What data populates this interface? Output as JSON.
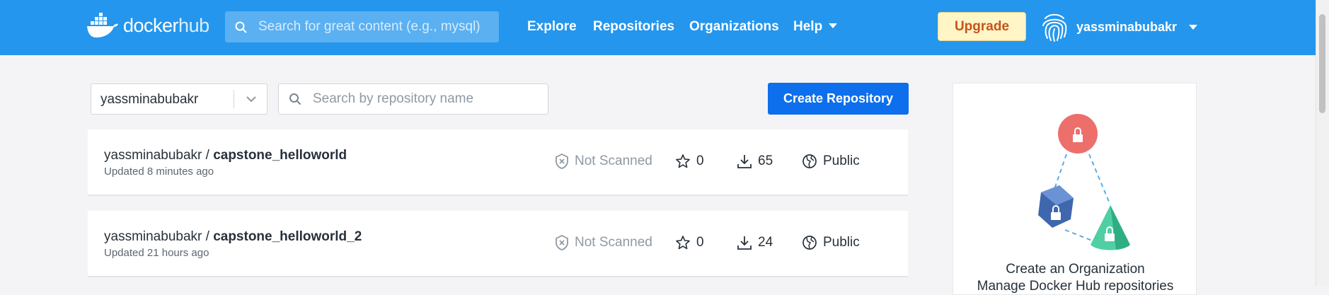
{
  "nav": {
    "logo_docker": "docker",
    "logo_hub": "hub",
    "search_placeholder": "Search for great content (e.g., mysql)",
    "links": [
      "Explore",
      "Repositories",
      "Organizations",
      "Help"
    ],
    "upgrade_label": "Upgrade",
    "username": "yassminabubakr"
  },
  "filters": {
    "namespace": "yassminabubakr",
    "repo_search_placeholder": "Search by repository name",
    "create_label": "Create Repository"
  },
  "repos": [
    {
      "owner": "yassminabubakr",
      "separator": " / ",
      "name": "capstone_helloworld",
      "updated": "Updated 8 minutes ago",
      "scan": "Not Scanned",
      "stars": "0",
      "pulls": "65",
      "visibility": "Public"
    },
    {
      "owner": "yassminabubakr",
      "separator": " / ",
      "name": "capstone_helloworld_2",
      "updated": "Updated 21 hours ago",
      "scan": "Not Scanned",
      "stars": "0",
      "pulls": "24",
      "visibility": "Public"
    }
  ],
  "org_card": {
    "title": "Create an Organization",
    "subtitle": "Manage Docker Hub repositories"
  },
  "colors": {
    "brand": "#2496ed",
    "primary_button": "#0d6fec",
    "upgrade_bg": "#fff5c6",
    "upgrade_text": "#c7531d"
  },
  "icons": [
    "docker-whale-icon",
    "search-icon",
    "fingerprint-avatar-icon",
    "chevron-down-icon",
    "shield-x-icon",
    "star-icon",
    "download-icon",
    "public-icon",
    "lock-icon"
  ]
}
